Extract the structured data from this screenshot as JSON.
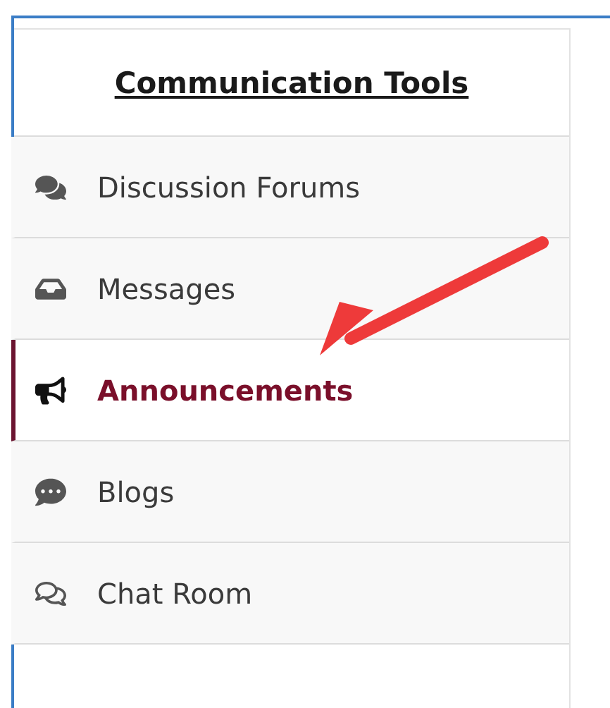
{
  "panel": {
    "heading": "Communication Tools",
    "items": [
      {
        "label": "Discussion Forums",
        "selected": false
      },
      {
        "label": "Messages",
        "selected": false
      },
      {
        "label": "Announcements",
        "selected": true
      },
      {
        "label": "Blogs",
        "selected": false
      },
      {
        "label": "Chat Room",
        "selected": false
      }
    ]
  }
}
